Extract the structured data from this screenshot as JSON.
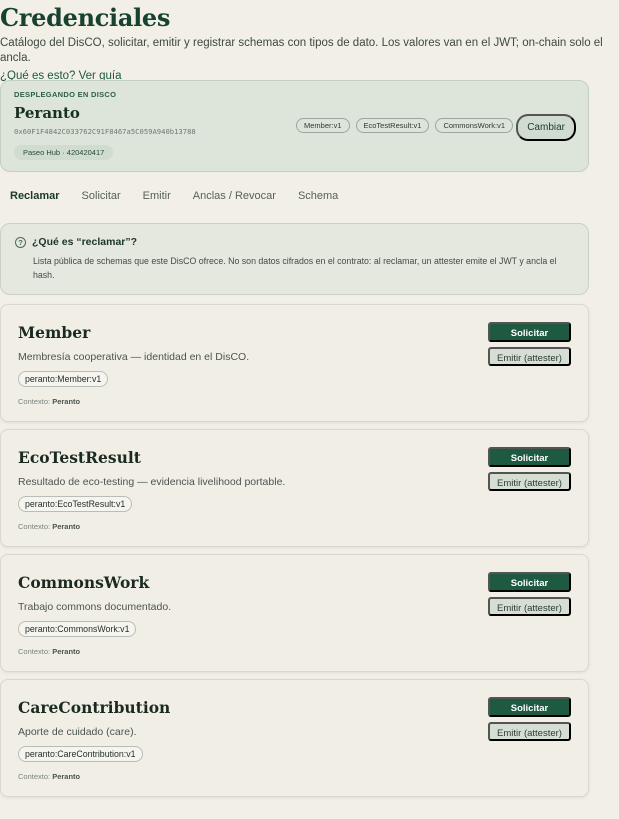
{
  "header": {
    "title": "Credenciales",
    "subtitle": "Catálogo del DisCO, solicitar, emitir y registrar schemas con tipos de dato. Los valores van en el JWT; on-chain solo el ancla.",
    "guide_link": "¿Qué es esto? Ver guía"
  },
  "deploy": {
    "kicker": "DESPLEGANDO EN DISCO",
    "name": "Peranto",
    "address": "0x60F1F4842C033762C91F8467a5C059A940b13788",
    "network": "Paseo Hub · 420420417",
    "schemas": [
      "Member:v1",
      "EcoTestResult:v1",
      "CommonsWork:v1"
    ],
    "change_label": "Cambiar"
  },
  "tabs": [
    {
      "label": "Reclamar",
      "active": true
    },
    {
      "label": "Solicitar",
      "active": false
    },
    {
      "label": "Emitir",
      "active": false
    },
    {
      "label": "Anclas / Revocar",
      "active": false
    },
    {
      "label": "Schema",
      "active": false
    }
  ],
  "info": {
    "icon": "question-circle-icon",
    "title": "¿Qué es “reclamar”?",
    "body": "Lista pública de schemas que este DisCO ofrece. No son datos cifrados en el contrato: al reclamar, un attester emite el JWT y ancla el hash."
  },
  "cards": [
    {
      "title": "Member",
      "description": "Membresía cooperativa — identidad en el DisCO.",
      "schema_id": "peranto:Member:v1",
      "context_label": "Contexto:",
      "context_value": "Peranto",
      "request_label": "Solicitar",
      "issue_label": "Emitir (attester)"
    },
    {
      "title": "EcoTestResult",
      "description": "Resultado de eco-testing — evidencia livelihood portable.",
      "schema_id": "peranto:EcoTestResult:v1",
      "context_label": "Contexto:",
      "context_value": "Peranto",
      "request_label": "Solicitar",
      "issue_label": "Emitir (attester)"
    },
    {
      "title": "CommonsWork",
      "description": "Trabajo commons documentado.",
      "schema_id": "peranto:CommonsWork:v1",
      "context_label": "Contexto:",
      "context_value": "Peranto",
      "request_label": "Solicitar",
      "issue_label": "Emitir (attester)"
    },
    {
      "title": "CareContribution",
      "description": "Aporte de cuidado (care).",
      "schema_id": "peranto:CareContribution:v1",
      "context_label": "Contexto:",
      "context_value": "Peranto",
      "request_label": "Solicitar",
      "issue_label": "Emitir (attester)"
    }
  ],
  "colors": {
    "background": "#f2efe7",
    "accent": "#1e5a42",
    "title": "#17422f"
  }
}
